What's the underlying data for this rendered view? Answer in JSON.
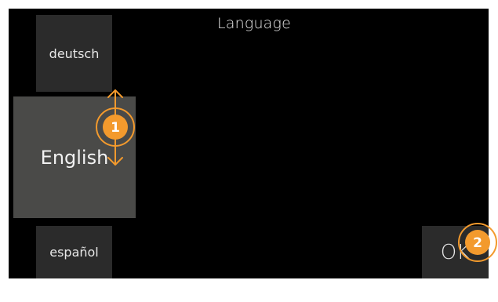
{
  "screen": {
    "title": "Language"
  },
  "languages": {
    "previous": "deutsch",
    "selected": "English",
    "next": "español"
  },
  "ok_button": {
    "label": "OK"
  },
  "annotations": {
    "accent_color": "#f39a2d",
    "step1": "1",
    "step2": "2"
  }
}
